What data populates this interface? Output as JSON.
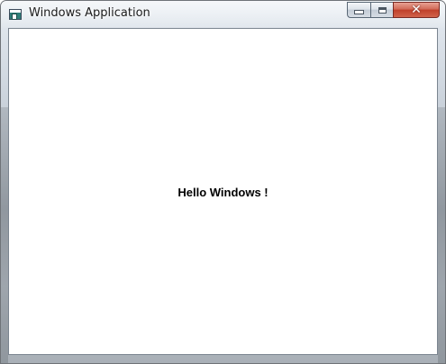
{
  "window": {
    "title": "Windows Application",
    "icon": "application-icon",
    "controls": {
      "minimize": "minimize-icon",
      "maximize": "maximize-icon",
      "close": "close-icon"
    }
  },
  "content": {
    "message": "Hello Windows !"
  },
  "colors": {
    "close_button": "#c0402a",
    "client_background": "#ffffff",
    "text": "#000000"
  }
}
